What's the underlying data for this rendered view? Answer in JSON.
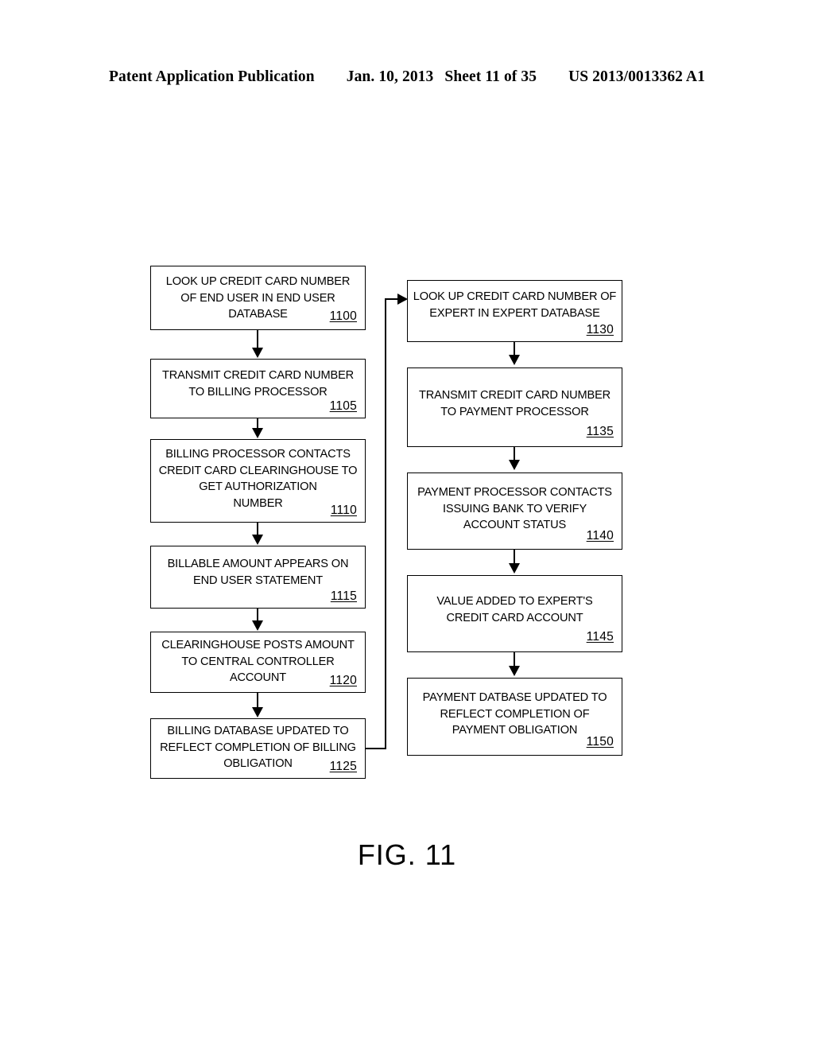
{
  "header": {
    "publication": "Patent Application Publication",
    "date": "Jan. 10, 2013",
    "sheet": "Sheet 11 of 35",
    "patent_number": "US 2013/0013362 A1"
  },
  "figure": {
    "caption": "FIG. 11",
    "nodes": [
      {
        "id": "1100",
        "ref": "1100",
        "text": "LOOK UP CREDIT CARD NUMBER\nOF END USER IN END USER\nDATABASE",
        "column": "left"
      },
      {
        "id": "1105",
        "ref": "1105",
        "text": "TRANSMIT CREDIT CARD NUMBER\nTO BILLING PROCESSOR",
        "column": "left"
      },
      {
        "id": "1110",
        "ref": "1110",
        "text": "BILLING PROCESSOR CONTACTS\nCREDIT CARD CLEARINGHOUSE TO\nGET AUTHORIZATION\nNUMBER",
        "column": "left"
      },
      {
        "id": "1115",
        "ref": "1115",
        "text": "BILLABLE AMOUNT APPEARS ON\nEND USER STATEMENT",
        "column": "left"
      },
      {
        "id": "1120",
        "ref": "1120",
        "text": "CLEARINGHOUSE POSTS AMOUNT\nTO CENTRAL CONTROLLER\nACCOUNT",
        "column": "left"
      },
      {
        "id": "1125",
        "ref": "1125",
        "text": "BILLING DATABASE UPDATED TO\nREFLECT COMPLETION OF BILLING\nOBLIGATION",
        "column": "left"
      },
      {
        "id": "1130",
        "ref": "1130",
        "text": "LOOK UP CREDIT CARD NUMBER OF\nEXPERT IN EXPERT DATABASE",
        "column": "right"
      },
      {
        "id": "1135",
        "ref": "1135",
        "text": "TRANSMIT CREDIT CARD NUMBER\nTO PAYMENT PROCESSOR",
        "column": "right"
      },
      {
        "id": "1140",
        "ref": "1140",
        "text": "PAYMENT PROCESSOR CONTACTS\nISSUING BANK TO VERIFY\nACCOUNT STATUS",
        "column": "right"
      },
      {
        "id": "1145",
        "ref": "1145",
        "text": "VALUE ADDED TO EXPERT'S\nCREDIT CARD ACCOUNT",
        "column": "right"
      },
      {
        "id": "1150",
        "ref": "1150",
        "text": "PAYMENT DATBASE UPDATED TO\nREFLECT COMPLETION OF\nPAYMENT OBLIGATION",
        "column": "right"
      }
    ],
    "flow_edges": [
      {
        "from": "1100",
        "to": "1105",
        "type": "down"
      },
      {
        "from": "1105",
        "to": "1110",
        "type": "down"
      },
      {
        "from": "1110",
        "to": "1115",
        "type": "down"
      },
      {
        "from": "1115",
        "to": "1120",
        "type": "down"
      },
      {
        "from": "1120",
        "to": "1125",
        "type": "down"
      },
      {
        "from": "1125",
        "to": "1130",
        "type": "right-up-right"
      },
      {
        "from": "1130",
        "to": "1135",
        "type": "down"
      },
      {
        "from": "1135",
        "to": "1140",
        "type": "down"
      },
      {
        "from": "1140",
        "to": "1145",
        "type": "down"
      },
      {
        "from": "1145",
        "to": "1150",
        "type": "down"
      }
    ]
  }
}
